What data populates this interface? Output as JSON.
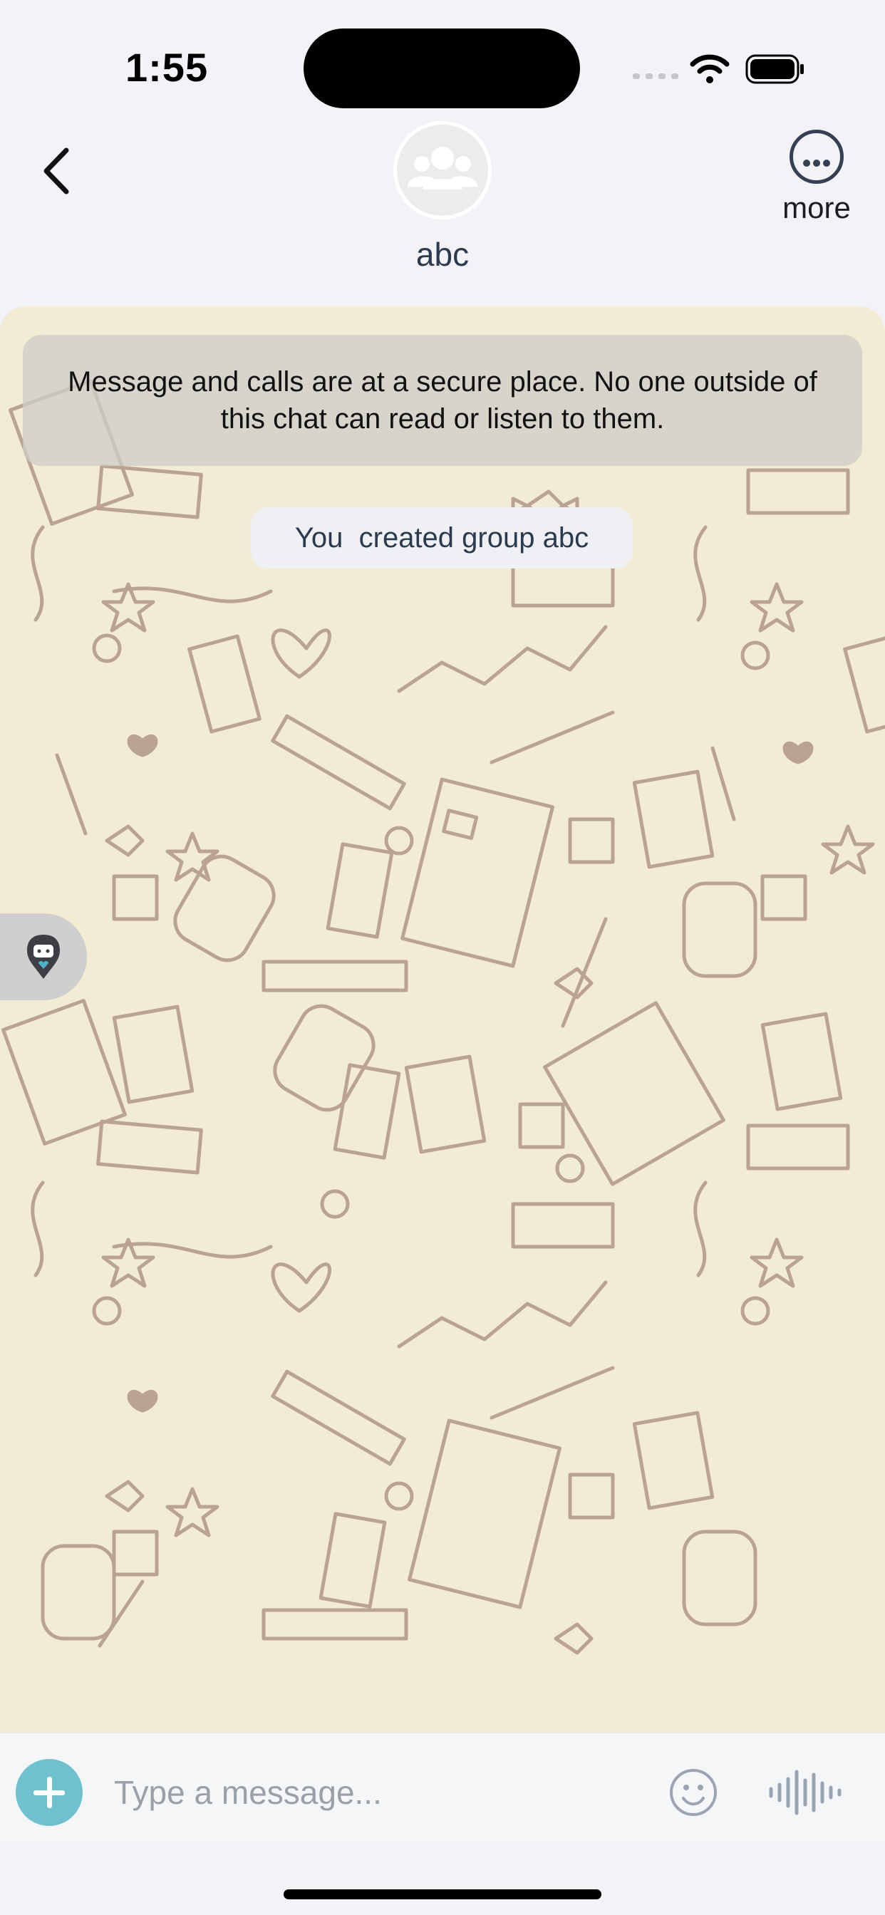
{
  "status_bar": {
    "time": "1:55"
  },
  "header": {
    "back_icon": "chevron-left-icon",
    "avatar_icon": "group-icon",
    "title": "abc",
    "more_label": "more",
    "more_icon": "ellipsis-circle-icon"
  },
  "chat": {
    "background_color": "#f1ecd3",
    "security_notice": "Message and calls are at a secure place. No one outside of this chat can read or listen to them.",
    "system_message": "You  created group abc"
  },
  "composer": {
    "placeholder": "Type a message...",
    "value": "",
    "add_icon": "plus-icon",
    "emoji_icon": "smiley-icon",
    "voice_icon": "waveform-icon",
    "accent_color": "#6fc1cf"
  }
}
